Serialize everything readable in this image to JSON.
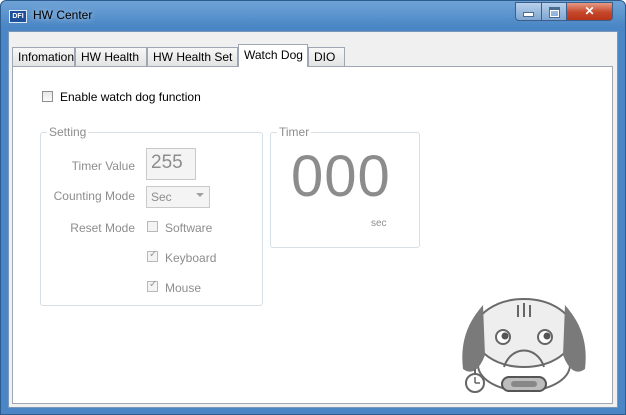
{
  "window": {
    "logo_text": "DFI",
    "title": "HW Center"
  },
  "tabs": [
    "Infomation",
    "HW Health",
    "HW Health Set",
    "Watch Dog",
    "DIO"
  ],
  "active_tab_index": 3,
  "watchdog": {
    "enable_label": "Enable watch dog function",
    "enable_checked": false,
    "setting": {
      "title": "Setting",
      "timer_value_label": "Timer Value",
      "timer_value": "255",
      "counting_mode_label": "Counting Mode",
      "counting_mode_value": "Sec",
      "reset_mode_label": "Reset Mode",
      "reset_options": [
        {
          "label": "Software",
          "checked": false
        },
        {
          "label": "Keyboard",
          "checked": true
        },
        {
          "label": "Mouse",
          "checked": true
        }
      ]
    },
    "timer": {
      "title": "Timer",
      "display": "000",
      "unit": "sec"
    }
  }
}
